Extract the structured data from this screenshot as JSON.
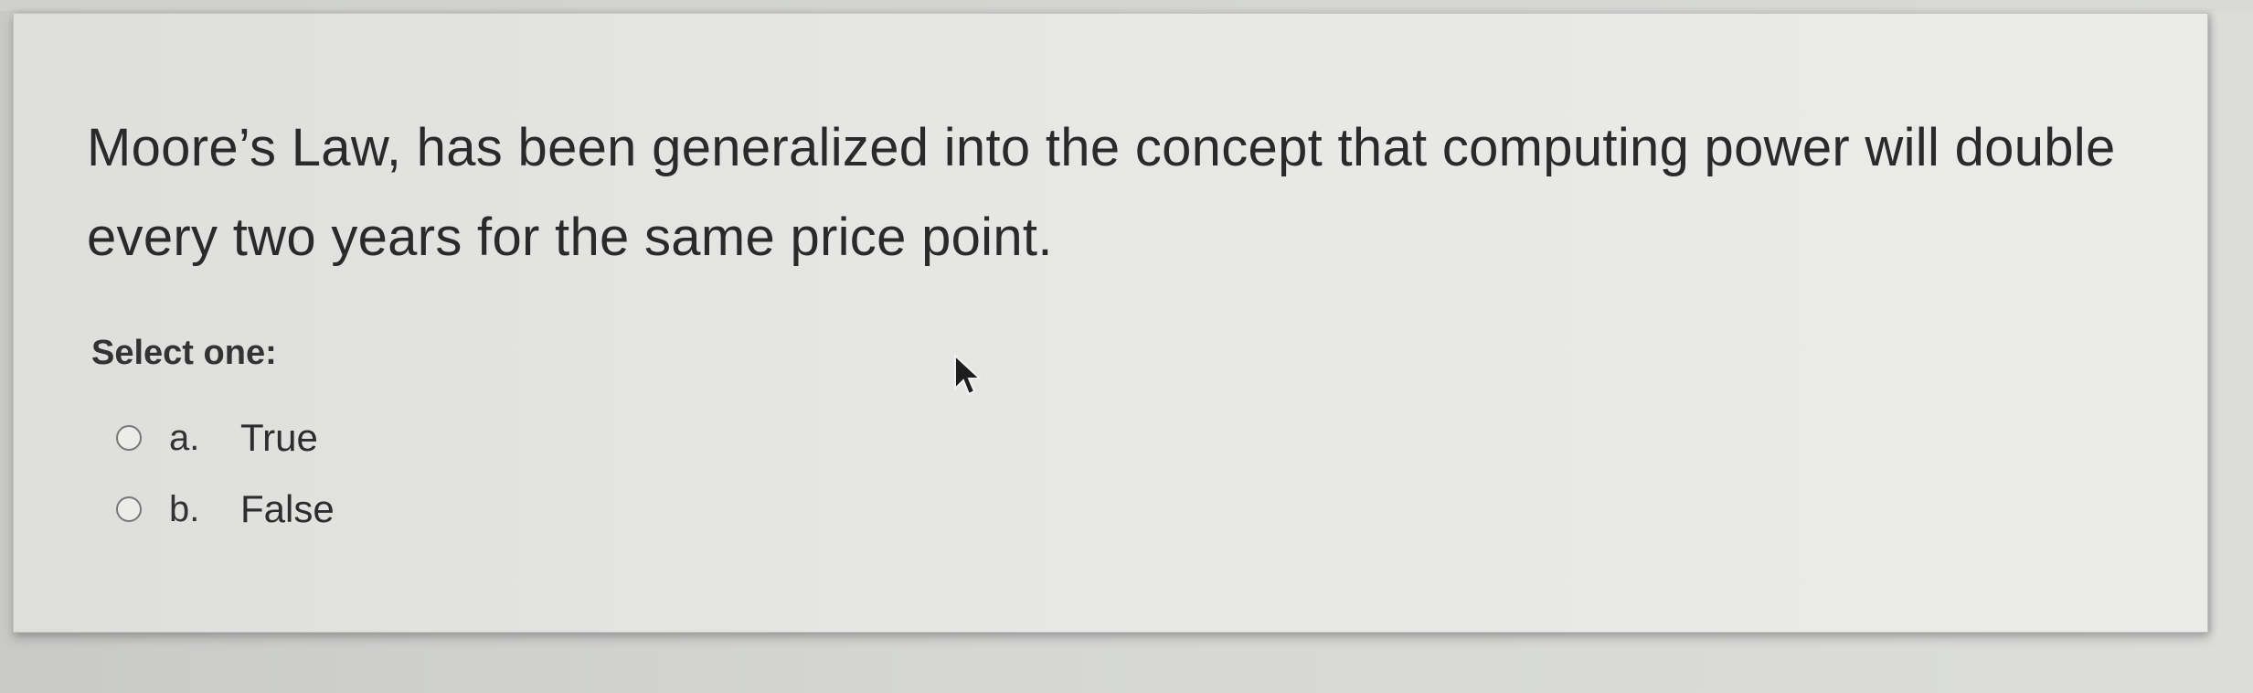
{
  "question": {
    "text": "Moore’s Law, has been generalized into the concept that computing power will double every two years for the same price point."
  },
  "answer_prompt": "Select one:",
  "options": [
    {
      "letter": "a.",
      "text": "True",
      "selected": false
    },
    {
      "letter": "b.",
      "text": "False",
      "selected": false
    }
  ],
  "icons": {
    "cursor": "mouse-pointer-icon",
    "radio": "radio-button-icon"
  },
  "colors": {
    "card_background": "#e6e7e5",
    "page_background": "#d6d7d5",
    "text": "#2a2a2a"
  }
}
